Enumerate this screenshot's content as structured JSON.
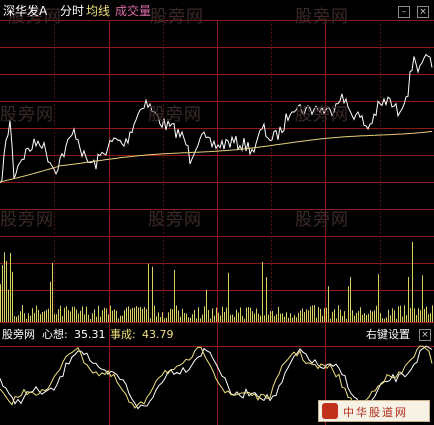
{
  "header": {
    "stock_name": "深华发A",
    "mode": "分时",
    "avg_line_label": "均线",
    "volume_label": "成交量"
  },
  "watermark": "股旁网",
  "indicator": {
    "source": "股旁网",
    "xin_xiang_label": "心想:",
    "xin_xiang_value": "35.31",
    "shi_cheng_label": "事成:",
    "shi_cheng_value": "43.79",
    "settings_label": "右键设置"
  },
  "window_controls": {
    "minimize_glyph": "–",
    "close_glyph": "×"
  },
  "stamp_text": "中华股道网",
  "colors": {
    "background": "#000000",
    "grid_red": "#8b1a1a",
    "grid_red_dark": "#5a0e0e",
    "price_line": "#ffffff",
    "avg_line": "#e8d27a",
    "volume_bar": "#d8d060",
    "indicator_line_1": "#ffffff",
    "indicator_line_2": "#f0e07a",
    "header_name": "#ffffff",
    "header_text": "#ffffff",
    "header_avg": "#f0e07a",
    "header_vol": "#d86aa8",
    "indicator_value_1": "#ffffff",
    "indicator_value_2": "#f0e07a"
  }
}
